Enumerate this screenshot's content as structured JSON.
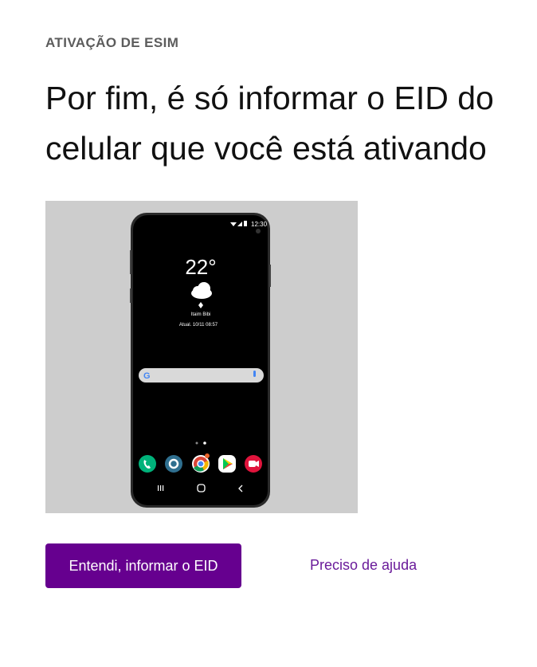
{
  "header": {
    "eyebrow": "ATIVAÇÃO DE ESIM",
    "title": "Por fim, é só informar o EID do celular que você está ativando"
  },
  "phone": {
    "status_time": "12:30",
    "temperature": "22°",
    "location": "Itaim Bibi",
    "updated": "Atual. 10/11 08:57",
    "icons": [
      "wifi-icon",
      "signal-icon",
      "battery-icon",
      "cloud-icon",
      "google-g-icon",
      "mic-icon",
      "phone-app-icon",
      "settings-app-icon",
      "chrome-app-icon",
      "play-store-app-icon",
      "video-app-icon",
      "recents-icon",
      "home-icon",
      "back-icon"
    ]
  },
  "actions": {
    "primary_label": "Entendi, informar o EID",
    "help_label": "Preciso de ajuda"
  },
  "colors": {
    "primary": "#66008f",
    "link": "#6a1b9a"
  }
}
